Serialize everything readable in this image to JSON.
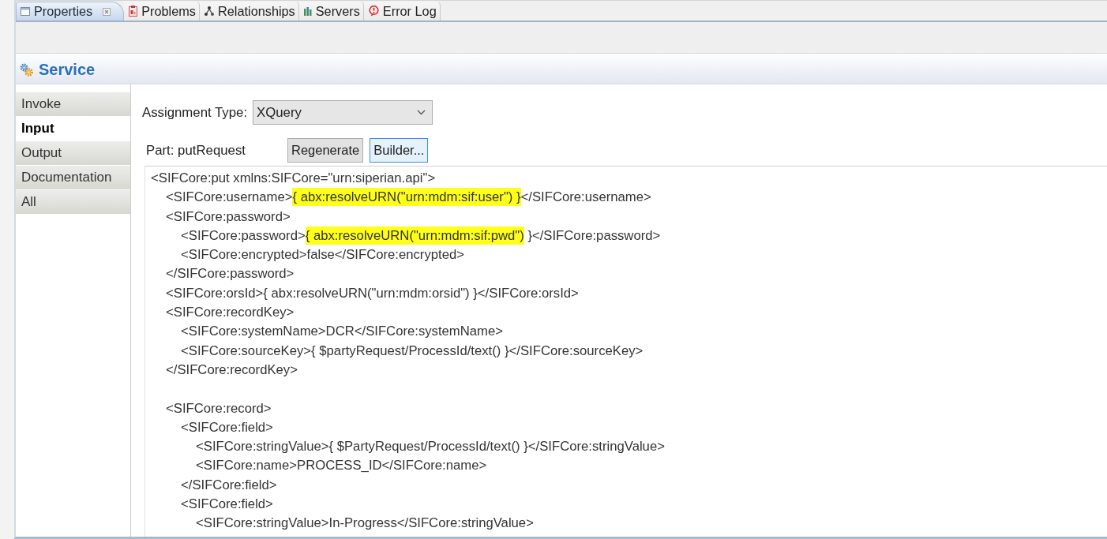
{
  "view_tabs": [
    {
      "label": "Properties",
      "selected": true,
      "closable": true
    },
    {
      "label": "Problems",
      "selected": false,
      "closable": false
    },
    {
      "label": "Relationships",
      "selected": false,
      "closable": false
    },
    {
      "label": "Servers",
      "selected": false,
      "closable": false
    },
    {
      "label": "Error Log",
      "selected": false,
      "closable": false
    }
  ],
  "section": {
    "title": "Service"
  },
  "side_tabs": [
    {
      "label": "Invoke",
      "selected": false
    },
    {
      "label": "Input",
      "selected": true
    },
    {
      "label": "Output",
      "selected": false
    },
    {
      "label": "Documentation",
      "selected": false
    },
    {
      "label": "All",
      "selected": false
    }
  ],
  "assignment": {
    "label": "Assignment Type:",
    "value": "XQuery"
  },
  "part": {
    "label": "Part: putRequest"
  },
  "buttons": [
    {
      "label": "Regenerate",
      "focused": false
    },
    {
      "label": "Builder...",
      "focused": true
    }
  ],
  "editor": {
    "lines": [
      {
        "segments": [
          {
            "text": "<SIFCore:put xmlns:SIFCore=\"urn:siperian.api\">",
            "highlighted": false
          }
        ],
        "children": [
          {
            "kind": "code",
            "segments": [
              {
                "text": "<SIFCore:username>",
                "highlighted": false
              },
              {
                "text": "{ abx:resolveURN(\"urn:mdm:sif:user\") }",
                "highlighted": true
              },
              {
                "text": "</SIFCore:username>",
                "highlighted": false
              }
            ]
          },
          {
            "kind": "code",
            "segments": [
              {
                "text": "<SIFCore:password>",
                "highlighted": false
              }
            ],
            "children": [
              {
                "segments": [
                  {
                    "text": "<SIFCore:password>",
                    "highlighted": false
                  },
                  {
                    "text": "{ abx:resolveURN(\"urn:mdm:sif:pwd\")",
                    "highlighted": true
                  },
                  {
                    "text": " }</SIFCore:password>",
                    "highlighted": false
                  }
                ]
              },
              {
                "segments": [
                  {
                    "text": "<SIFCore:encrypted>false</SIFCore:encrypted>",
                    "highlighted": false
                  }
                ]
              }
            ]
          },
          {
            "kind": "code",
            "segments": [
              {
                "text": "</SIFCore:password>",
                "highlighted": false
              }
            ]
          },
          {
            "kind": "code",
            "segments": [
              {
                "text": "<SIFCore:orsId>{ abx:resolveURN(\"urn:mdm:orsid\") }</SIFCore:orsId>",
                "highlighted": false
              }
            ]
          },
          {
            "kind": "code",
            "segments": [
              {
                "text": "<SIFCore:recordKey>",
                "highlighted": false
              }
            ],
            "children": [
              {
                "segments": [
                  {
                    "text": "<SIFCore:systemName>DCR</SIFCore:systemName>",
                    "highlighted": false
                  }
                ]
              },
              {
                "segments": [
                  {
                    "text": "<SIFCore:sourceKey>{ $partyRequest/ProcessId/text() }</SIFCore:sourceKey>",
                    "highlighted": false
                  }
                ]
              }
            ]
          },
          {
            "kind": "code",
            "segments": [
              {
                "text": "</SIFCore:recordKey>",
                "highlighted": false
              }
            ]
          },
          {
            "kind": "blank"
          },
          {
            "kind": "code",
            "segments": [
              {
                "text": "<SIFCore:record>",
                "highlighted": false
              }
            ],
            "children": [
              {
                "segments": [
                  {
                    "text": "<SIFCore:field>",
                    "highlighted": false
                  }
                ],
                "children": [
                  {
                    "segments": [
                      {
                        "text": "<SIFCore:stringValue>{ $PartyRequest/ProcessId/text() }</SIFCore:stringValue>",
                        "highlighted": false
                      }
                    ]
                  },
                  {
                    "segments": [
                      {
                        "text": "<SIFCore:name>PROCESS_ID</SIFCore:name>",
                        "highlighted": false
                      }
                    ]
                  }
                ]
              },
              {
                "segments": [
                  {
                    "text": "</SIFCore:field>",
                    "highlighted": false
                  }
                ]
              },
              {
                "segments": [
                  {
                    "text": "<SIFCore:field>",
                    "highlighted": false
                  }
                ],
                "children": [
                  {
                    "segments": [
                      {
                        "text": "<SIFCore:stringValue>In-Progress</SIFCore:stringValue>",
                        "highlighted": false
                      }
                    ]
                  }
                ]
              }
            ]
          }
        ]
      }
    ]
  }
}
